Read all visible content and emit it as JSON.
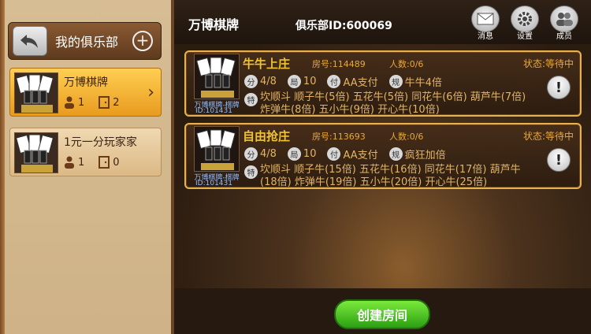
{
  "sidebar": {
    "title": "我的俱乐部",
    "clubs": [
      {
        "name": "万博棋牌",
        "members": "1",
        "rooms": "2",
        "active": true
      },
      {
        "name": "1元一分玩家家",
        "members": "1",
        "rooms": "0",
        "active": false
      }
    ]
  },
  "header": {
    "app_name": "万博棋牌",
    "club_id": "俱乐部ID:600069",
    "buttons": [
      {
        "label": "消息",
        "icon": "envelope-icon"
      },
      {
        "label": "设置",
        "icon": "gear-icon"
      },
      {
        "label": "成员",
        "icon": "members-icon"
      }
    ]
  },
  "rooms": [
    {
      "name": "牛牛上庄",
      "room_no": "房号:114489",
      "players": "人数:0/6",
      "status": "状态:等待中",
      "score_label": "分",
      "score": "4/8",
      "rounds_label": "局",
      "rounds": "10",
      "pay_label": "付",
      "pay": "AA支付",
      "rule_label": "规",
      "rule": "牛牛4倍",
      "special_label": "特",
      "special": "坎顺斗 顺子牛(5倍) 五花牛(5倍) 同花牛(6倍) 葫芦牛(7倍) 炸弹牛(8倍) 五小牛(9倍) 开心牛(10倍)",
      "thumb_caption": "万博棋牌-棋牌",
      "owner_id": "ID:101431"
    },
    {
      "name": "自由抢庄",
      "room_no": "房号:113693",
      "players": "人数:0/6",
      "status": "状态:等待中",
      "score_label": "分",
      "score": "4/8",
      "rounds_label": "局",
      "rounds": "10",
      "pay_label": "付",
      "pay": "AA支付",
      "rule_label": "规",
      "rule": "疯狂加倍",
      "special_label": "特",
      "special": "坎顺斗 顺子牛(15倍) 五花牛(16倍) 同花牛(17倍) 葫芦牛(18倍) 炸弹牛(19倍) 五小牛(20倍) 开心牛(25倍)",
      "thumb_caption": "万博棋牌-棋牌",
      "owner_id": "ID:101431"
    }
  ],
  "footer": {
    "create_label": "创建房间"
  },
  "colors": {
    "accent_gold": "#f1c331",
    "room_border": "#e7b24d",
    "create_green": "#2a9f12"
  }
}
